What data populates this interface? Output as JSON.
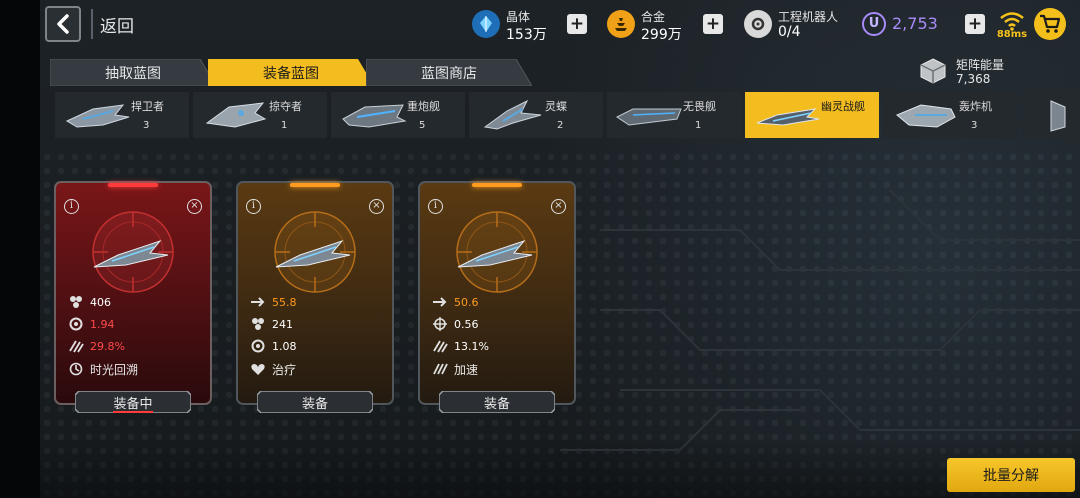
{
  "header": {
    "back_label": "返回"
  },
  "resources": {
    "crystal": {
      "name": "晶体",
      "value": "153万"
    },
    "alloy": {
      "name": "合金",
      "value": "299万"
    },
    "robots": {
      "name": "工程机器人",
      "value": "0/4"
    },
    "u_currency": {
      "symbol": "U",
      "value": "2,753"
    },
    "ping": "88ms"
  },
  "tabs": [
    {
      "label": "抽取蓝图",
      "active": false
    },
    {
      "label": "装备蓝图",
      "active": true
    },
    {
      "label": "蓝图商店",
      "active": false
    }
  ],
  "matrix": {
    "label": "矩阵能量",
    "value": "7,368"
  },
  "ships": [
    {
      "name": "捍卫者",
      "count": "3",
      "active": false
    },
    {
      "name": "掠夺者",
      "count": "1",
      "active": false
    },
    {
      "name": "重炮舰",
      "count": "5",
      "active": false
    },
    {
      "name": "灵蝶",
      "count": "2",
      "active": false
    },
    {
      "name": "无畏舰",
      "count": "1",
      "active": false
    },
    {
      "name": "幽灵战舰",
      "count": "",
      "active": true
    },
    {
      "name": "轰炸机",
      "count": "3",
      "active": false
    }
  ],
  "cards": [
    {
      "theme": "red",
      "stats": [
        {
          "icon": "attack-cluster-icon",
          "value": "406",
          "color": "#ffffff"
        },
        {
          "icon": "gear-icon",
          "value": "1.94",
          "color": "#ff4b4b"
        },
        {
          "icon": "claw-icon",
          "value": "29.8%",
          "color": "#ff4b4b"
        }
      ],
      "skill": {
        "icon": "time-rewind-icon",
        "name": "时光回溯"
      },
      "button": "装备中"
    },
    {
      "theme": "orange",
      "stats": [
        {
          "icon": "arrow-right-icon",
          "value": "55.8",
          "color": "#ff9b1f"
        },
        {
          "icon": "attack-cluster-icon",
          "value": "241",
          "color": "#ffffff"
        },
        {
          "icon": "gear-icon",
          "value": "1.08",
          "color": "#ffffff"
        }
      ],
      "skill": {
        "icon": "heal-icon",
        "name": "治疗"
      },
      "button": "装备"
    },
    {
      "theme": "orange",
      "stats": [
        {
          "icon": "arrow-right-icon",
          "value": "50.6",
          "color": "#ff9b1f"
        },
        {
          "icon": "crosshair-icon",
          "value": "0.56",
          "color": "#ffffff"
        },
        {
          "icon": "claw-icon",
          "value": "13.1%",
          "color": "#ffffff"
        }
      ],
      "skill": {
        "icon": "speed-up-icon",
        "name": "加速"
      },
      "button": "装备"
    }
  ],
  "bulk_button": "批量分解",
  "colors": {
    "accent": "#f3bd20",
    "u_purple": "#a78bfa",
    "red_value": "#ff4b4b",
    "orange_value": "#ff9b1f"
  }
}
